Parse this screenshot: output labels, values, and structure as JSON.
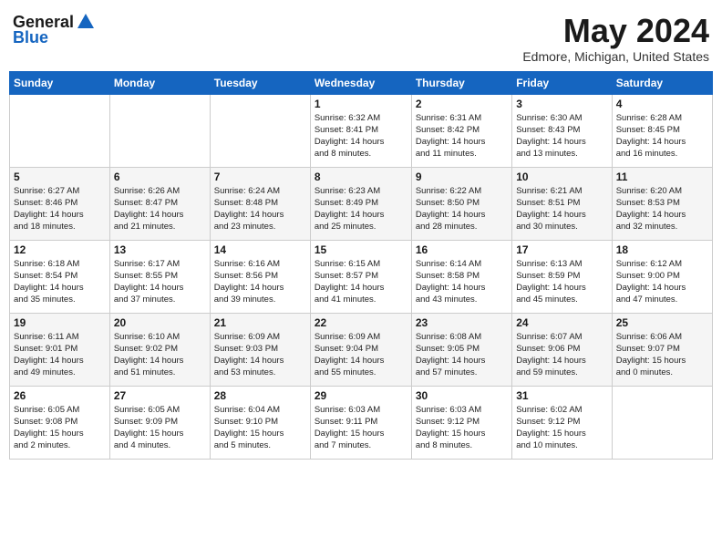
{
  "header": {
    "logo_general": "General",
    "logo_blue": "Blue",
    "title": "May 2024",
    "location": "Edmore, Michigan, United States"
  },
  "days_of_week": [
    "Sunday",
    "Monday",
    "Tuesday",
    "Wednesday",
    "Thursday",
    "Friday",
    "Saturday"
  ],
  "weeks": [
    [
      {
        "day": "",
        "info": ""
      },
      {
        "day": "",
        "info": ""
      },
      {
        "day": "",
        "info": ""
      },
      {
        "day": "1",
        "info": "Sunrise: 6:32 AM\nSunset: 8:41 PM\nDaylight: 14 hours\nand 8 minutes."
      },
      {
        "day": "2",
        "info": "Sunrise: 6:31 AM\nSunset: 8:42 PM\nDaylight: 14 hours\nand 11 minutes."
      },
      {
        "day": "3",
        "info": "Sunrise: 6:30 AM\nSunset: 8:43 PM\nDaylight: 14 hours\nand 13 minutes."
      },
      {
        "day": "4",
        "info": "Sunrise: 6:28 AM\nSunset: 8:45 PM\nDaylight: 14 hours\nand 16 minutes."
      }
    ],
    [
      {
        "day": "5",
        "info": "Sunrise: 6:27 AM\nSunset: 8:46 PM\nDaylight: 14 hours\nand 18 minutes."
      },
      {
        "day": "6",
        "info": "Sunrise: 6:26 AM\nSunset: 8:47 PM\nDaylight: 14 hours\nand 21 minutes."
      },
      {
        "day": "7",
        "info": "Sunrise: 6:24 AM\nSunset: 8:48 PM\nDaylight: 14 hours\nand 23 minutes."
      },
      {
        "day": "8",
        "info": "Sunrise: 6:23 AM\nSunset: 8:49 PM\nDaylight: 14 hours\nand 25 minutes."
      },
      {
        "day": "9",
        "info": "Sunrise: 6:22 AM\nSunset: 8:50 PM\nDaylight: 14 hours\nand 28 minutes."
      },
      {
        "day": "10",
        "info": "Sunrise: 6:21 AM\nSunset: 8:51 PM\nDaylight: 14 hours\nand 30 minutes."
      },
      {
        "day": "11",
        "info": "Sunrise: 6:20 AM\nSunset: 8:53 PM\nDaylight: 14 hours\nand 32 minutes."
      }
    ],
    [
      {
        "day": "12",
        "info": "Sunrise: 6:18 AM\nSunset: 8:54 PM\nDaylight: 14 hours\nand 35 minutes."
      },
      {
        "day": "13",
        "info": "Sunrise: 6:17 AM\nSunset: 8:55 PM\nDaylight: 14 hours\nand 37 minutes."
      },
      {
        "day": "14",
        "info": "Sunrise: 6:16 AM\nSunset: 8:56 PM\nDaylight: 14 hours\nand 39 minutes."
      },
      {
        "day": "15",
        "info": "Sunrise: 6:15 AM\nSunset: 8:57 PM\nDaylight: 14 hours\nand 41 minutes."
      },
      {
        "day": "16",
        "info": "Sunrise: 6:14 AM\nSunset: 8:58 PM\nDaylight: 14 hours\nand 43 minutes."
      },
      {
        "day": "17",
        "info": "Sunrise: 6:13 AM\nSunset: 8:59 PM\nDaylight: 14 hours\nand 45 minutes."
      },
      {
        "day": "18",
        "info": "Sunrise: 6:12 AM\nSunset: 9:00 PM\nDaylight: 14 hours\nand 47 minutes."
      }
    ],
    [
      {
        "day": "19",
        "info": "Sunrise: 6:11 AM\nSunset: 9:01 PM\nDaylight: 14 hours\nand 49 minutes."
      },
      {
        "day": "20",
        "info": "Sunrise: 6:10 AM\nSunset: 9:02 PM\nDaylight: 14 hours\nand 51 minutes."
      },
      {
        "day": "21",
        "info": "Sunrise: 6:09 AM\nSunset: 9:03 PM\nDaylight: 14 hours\nand 53 minutes."
      },
      {
        "day": "22",
        "info": "Sunrise: 6:09 AM\nSunset: 9:04 PM\nDaylight: 14 hours\nand 55 minutes."
      },
      {
        "day": "23",
        "info": "Sunrise: 6:08 AM\nSunset: 9:05 PM\nDaylight: 14 hours\nand 57 minutes."
      },
      {
        "day": "24",
        "info": "Sunrise: 6:07 AM\nSunset: 9:06 PM\nDaylight: 14 hours\nand 59 minutes."
      },
      {
        "day": "25",
        "info": "Sunrise: 6:06 AM\nSunset: 9:07 PM\nDaylight: 15 hours\nand 0 minutes."
      }
    ],
    [
      {
        "day": "26",
        "info": "Sunrise: 6:05 AM\nSunset: 9:08 PM\nDaylight: 15 hours\nand 2 minutes."
      },
      {
        "day": "27",
        "info": "Sunrise: 6:05 AM\nSunset: 9:09 PM\nDaylight: 15 hours\nand 4 minutes."
      },
      {
        "day": "28",
        "info": "Sunrise: 6:04 AM\nSunset: 9:10 PM\nDaylight: 15 hours\nand 5 minutes."
      },
      {
        "day": "29",
        "info": "Sunrise: 6:03 AM\nSunset: 9:11 PM\nDaylight: 15 hours\nand 7 minutes."
      },
      {
        "day": "30",
        "info": "Sunrise: 6:03 AM\nSunset: 9:12 PM\nDaylight: 15 hours\nand 8 minutes."
      },
      {
        "day": "31",
        "info": "Sunrise: 6:02 AM\nSunset: 9:12 PM\nDaylight: 15 hours\nand 10 minutes."
      },
      {
        "day": "",
        "info": ""
      }
    ]
  ]
}
